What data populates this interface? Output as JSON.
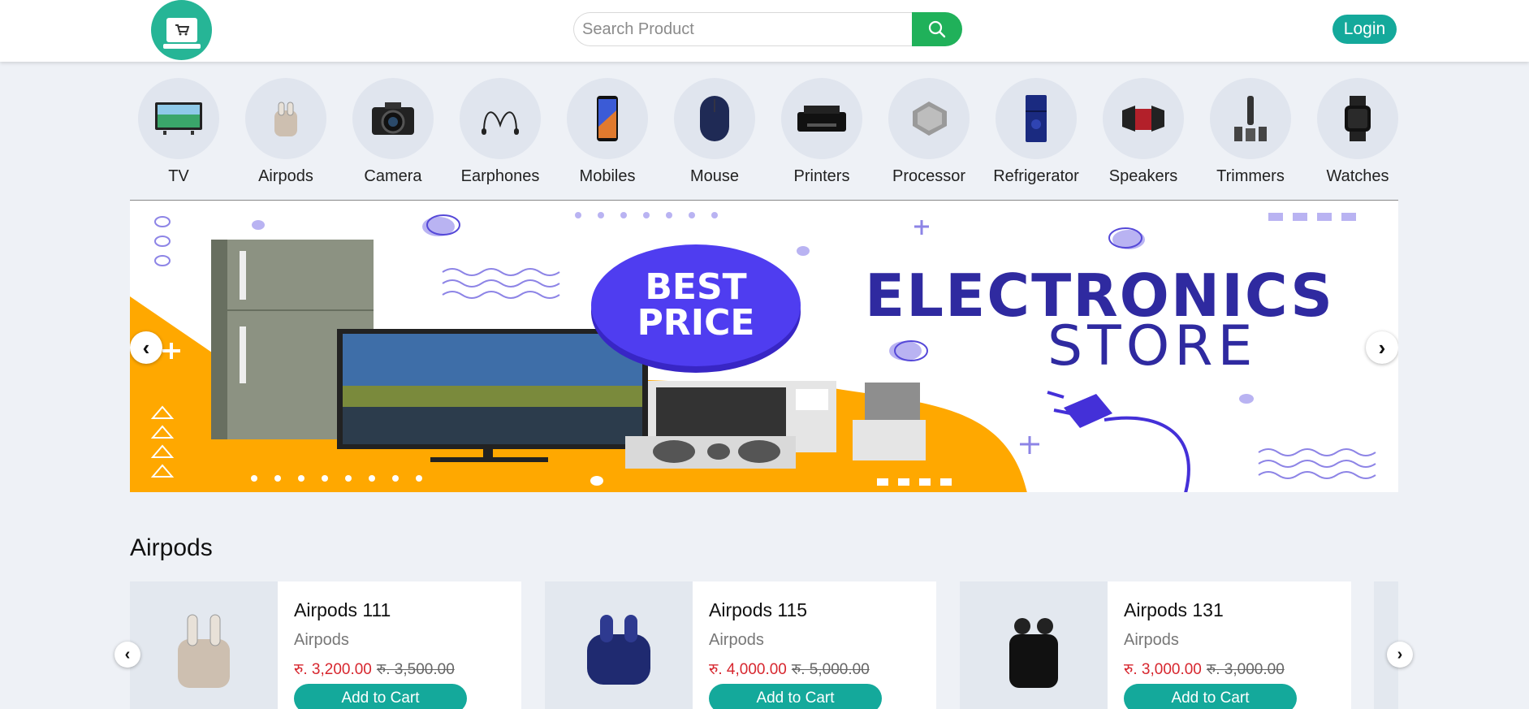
{
  "header": {
    "search_placeholder": "Search Product",
    "login_label": "Login"
  },
  "categories": [
    {
      "label": "TV",
      "icon": "tv-icon"
    },
    {
      "label": "Airpods",
      "icon": "airpods-icon"
    },
    {
      "label": "Camera",
      "icon": "camera-icon"
    },
    {
      "label": "Earphones",
      "icon": "earphones-icon"
    },
    {
      "label": "Mobiles",
      "icon": "mobile-icon"
    },
    {
      "label": "Mouse",
      "icon": "mouse-icon"
    },
    {
      "label": "Printers",
      "icon": "printer-icon"
    },
    {
      "label": "Processor",
      "icon": "processor-icon"
    },
    {
      "label": "Refrigerator",
      "icon": "refrigerator-icon"
    },
    {
      "label": "Speakers",
      "icon": "speaker-icon"
    },
    {
      "label": "Trimmers",
      "icon": "trimmer-icon"
    },
    {
      "label": "Watches",
      "icon": "watch-icon"
    }
  ],
  "banner": {
    "badge_line1": "BEST",
    "badge_line2": "PRICE",
    "title": "ELECTRONICS",
    "subtitle": "STORE"
  },
  "section": {
    "title": "Airpods",
    "products": [
      {
        "name": "Airpods 111",
        "category": "Airpods",
        "price": "रु. 3,200.00",
        "old_price": "रु. 3,500.00",
        "button": "Add to Cart"
      },
      {
        "name": "Airpods 115",
        "category": "Airpods",
        "price": "रु. 4,000.00",
        "old_price": "रु. 5,000.00",
        "button": "Add to Cart"
      },
      {
        "name": "Airpods 131",
        "category": "Airpods",
        "price": "रु. 3,000.00",
        "old_price": "रु. 3,000.00",
        "button": "Add to Cart"
      }
    ]
  },
  "colors": {
    "accent": "#14a99b",
    "search_button": "#20b15a",
    "price": "#d7262e",
    "banner_title": "#2f2aa0"
  }
}
